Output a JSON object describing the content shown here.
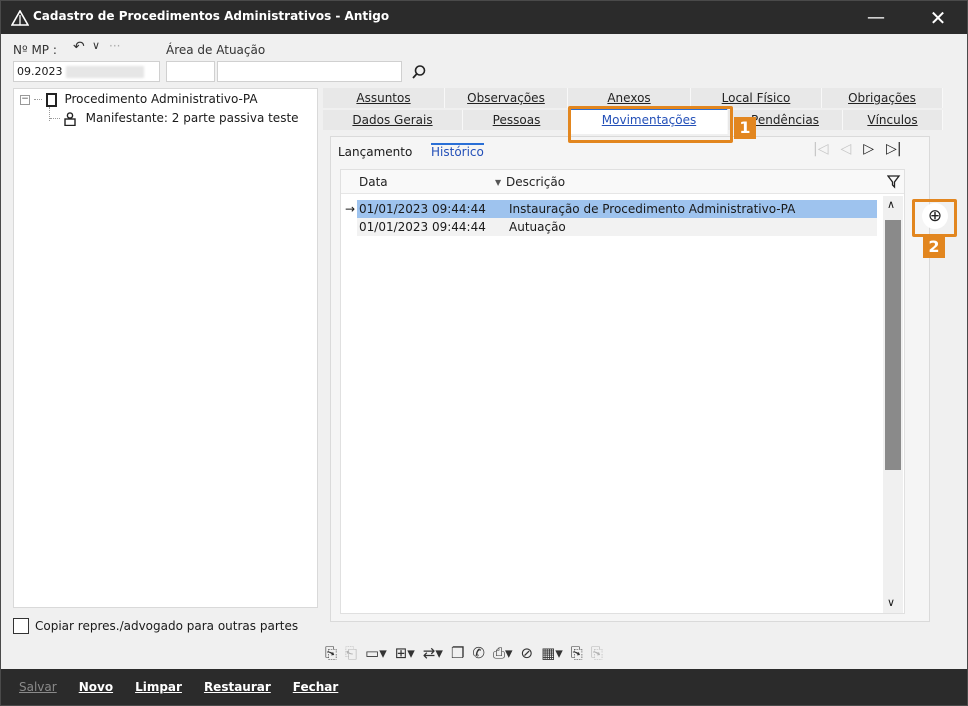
{
  "window": {
    "title": "Cadastro de Procedimentos Administrativos - Antigo",
    "minimize": "—",
    "close": "✕"
  },
  "form": {
    "mp_label": "Nº MP :",
    "mp_value": "09.2023",
    "area_label": "Área de Atuação"
  },
  "tree": {
    "root_label": "Procedimento Administrativo-PA",
    "child_label": "Manifestante: 2 parte passiva teste"
  },
  "tabs": {
    "row1": [
      "Assuntos",
      "Observações",
      "Anexos",
      "Local Físico",
      "Obrigações"
    ],
    "row2": [
      "Dados Gerais",
      "Pessoas",
      "Movimentações",
      "Pendências",
      "Vínculos"
    ]
  },
  "subtabs": [
    "Lançamento",
    "Histórico"
  ],
  "grid": {
    "columns": [
      "Data",
      "Descrição"
    ],
    "rows": [
      {
        "date": "01/01/2023 09:44:44",
        "desc": "Instauração de Procedimento Administrativo-PA"
      },
      {
        "date": "01/01/2023 09:44:44",
        "desc": "Autuação"
      }
    ]
  },
  "callouts": [
    "1",
    "2"
  ],
  "copy_checkbox_label": "Copiar repres./advogado para outras partes",
  "bottom_buttons": [
    "Salvar",
    "Novo",
    "Limpar",
    "Restaurar",
    "Fechar"
  ],
  "colors": {
    "titlebar": "#2b2b2b",
    "accent": "#2a6fd6",
    "callout": "#e2861f",
    "selected_row": "#9ec3ee"
  }
}
